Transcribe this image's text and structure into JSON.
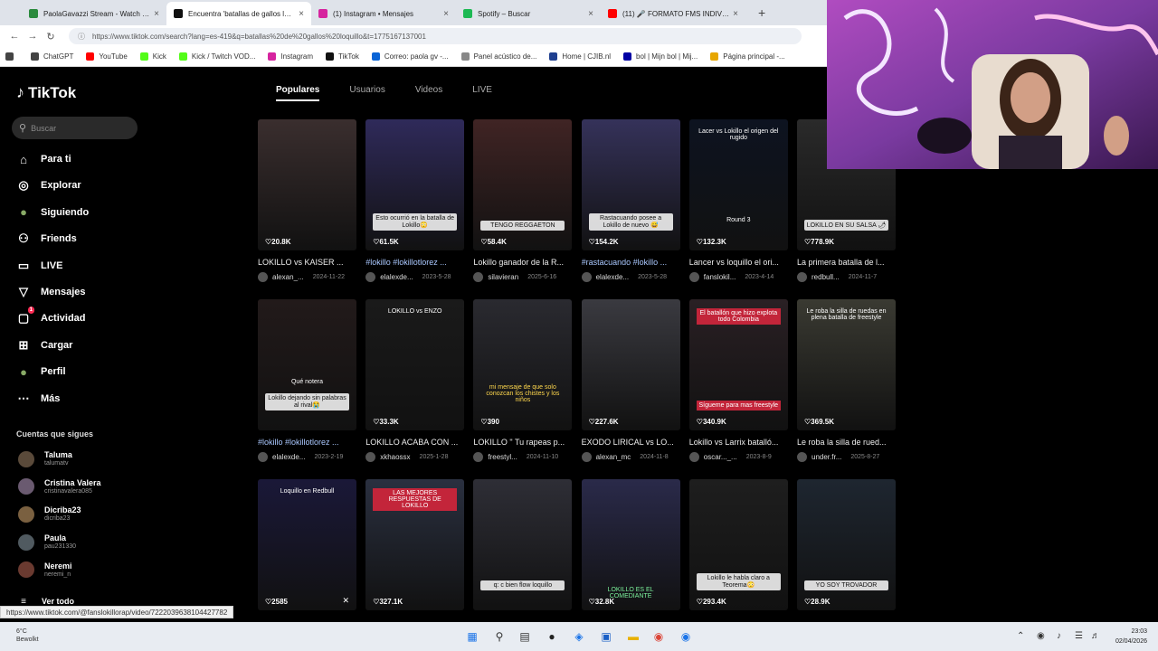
{
  "browser": {
    "tabs": [
      {
        "title": "PaolaGavazzi Stream - Watch Live",
        "color": "#2b8a3e",
        "active": false
      },
      {
        "title": "Encuentra 'batallas de gallos loquillo'",
        "color": "#111111",
        "active": true
      },
      {
        "title": "(1) Instagram • Mensajes",
        "color": "#d6249f",
        "active": false
      },
      {
        "title": "Spotify – Buscar",
        "color": "#1db954",
        "active": false
      },
      {
        "title": "(11) 🎤 FORMATO FMS INDIVIDUAL",
        "color": "#ff0000",
        "active": false
      }
    ],
    "new_tab": "+",
    "url": "https://www.tiktok.com/search?lang=es-419&q=batallas%20de%20gallos%20loquillo&t=1775167137001",
    "bookmarks": [
      {
        "label": "ChatGPT",
        "color": "#444444"
      },
      {
        "label": "YouTube",
        "color": "#ff0000"
      },
      {
        "label": "Kick",
        "color": "#53fc18"
      },
      {
        "label": "Kick / Twitch VOD...",
        "color": "#53fc18"
      },
      {
        "label": "Instagram",
        "color": "#d6249f"
      },
      {
        "label": "TikTok",
        "color": "#111111"
      },
      {
        "label": "Correo: paola gv -...",
        "color": "#0a64d6"
      },
      {
        "label": "Panel acústico de...",
        "color": "#888888"
      },
      {
        "label": "Home | CJIB.nl",
        "color": "#1f3f8f"
      },
      {
        "label": "bol | Mijn bol | Mij...",
        "color": "#0000a4"
      },
      {
        "label": "Página principal -...",
        "color": "#e7a600"
      }
    ]
  },
  "tiktok": {
    "logo": "TikTok",
    "search_placeholder": "Buscar",
    "nav": [
      {
        "label": "Para ti",
        "icon": "home-icon",
        "glyph": "⌂"
      },
      {
        "label": "Explorar",
        "icon": "compass-icon",
        "glyph": "◎"
      },
      {
        "label": "Siguiendo",
        "icon": "following-avatar-icon",
        "glyph": "●"
      },
      {
        "label": "Friends",
        "icon": "friends-icon",
        "glyph": "⚇"
      },
      {
        "label": "LIVE",
        "icon": "live-icon",
        "glyph": "▭"
      },
      {
        "label": "Mensajes",
        "icon": "messages-icon",
        "glyph": "▽"
      },
      {
        "label": "Actividad",
        "icon": "activity-icon",
        "glyph": "▢"
      },
      {
        "label": "Cargar",
        "icon": "upload-icon",
        "glyph": "⊞"
      },
      {
        "label": "Perfil",
        "icon": "profile-avatar-icon",
        "glyph": "●"
      },
      {
        "label": "Más",
        "icon": "more-icon",
        "glyph": "⋯"
      }
    ],
    "activity_badge": "1",
    "following_header": "Cuentas que sigues",
    "following": [
      {
        "name": "Taluma",
        "handle": "talumatv"
      },
      {
        "name": "Cristina Valera",
        "handle": "cristinavalera085"
      },
      {
        "name": "Dicriba23",
        "handle": "dicriba23"
      },
      {
        "name": "Paula",
        "handle": "pau231330"
      },
      {
        "name": "Neremi",
        "handle": "neremi_n"
      }
    ],
    "see_all": "Ver todo",
    "result_tabs": [
      "Populares",
      "Usuarios",
      "Videos",
      "LIVE"
    ],
    "active_tab": "Populares",
    "videos": [
      {
        "title": "LOKILLO vs KAISER ...",
        "user": "alexan_...",
        "date": "2024-11-22",
        "likes": "20.8K",
        "hashtag": false,
        "caption": "",
        "bg": "#3a2e2e"
      },
      {
        "title": "#lokillo #lokillotlorez ...",
        "user": "elalexde...",
        "date": "2023-5-28",
        "likes": "61.5K",
        "hashtag": true,
        "caption": "Esto ocurrió en la batalla de Lokillo😳",
        "bg": "#2f2a5a"
      },
      {
        "title": "Lokillo ganador de la R...",
        "user": "silavieran",
        "date": "2025-6-16",
        "likes": "58.4K",
        "hashtag": false,
        "caption": "",
        "bg": "#402424"
      },
      {
        "title": "#rastacuando #lokillo ...",
        "user": "elalexde...",
        "date": "2023-5-28",
        "likes": "154.2K",
        "hashtag": true,
        "caption": "Rastacuando posee a Lokillo de nuevo 😅",
        "bg": "#35325a"
      },
      {
        "title": "Lancer vs loquillo el ori...",
        "user": "fanslokil...",
        "date": "2023-4-14",
        "likes": "132.3K",
        "hashtag": false,
        "caption": "",
        "bg": "#0d1320"
      },
      {
        "title": "La primera batalla de l...",
        "user": "redbull...",
        "date": "2024-11-7",
        "likes": "778.9K",
        "hashtag": false,
        "caption": "LOKILLO EN SU SALSA 🌶",
        "bg": "#2a2a2a"
      },
      {
        "title": "#lokillo #lokillotlorez ...",
        "user": "elalexde...",
        "date": "2023-2-19",
        "likes": "",
        "hashtag": true,
        "caption": "Lokillo dejando sin palabras al rival😭",
        "bg": "#221a1a"
      },
      {
        "title": "LOKILLO ACABA CON ...",
        "user": "xkhaossx",
        "date": "2025-1-28",
        "likes": "33.3K",
        "hashtag": false,
        "caption": "",
        "bg": "#1a1a1a"
      },
      {
        "title": "LOKILLO \" Tu rapeas p...",
        "user": "freestyl...",
        "date": "2024-11-10",
        "likes": "390",
        "hashtag": false,
        "caption": "",
        "bg": "#2a2a30"
      },
      {
        "title": "EXODO LIRICAL vs LO...",
        "user": "alexan_mc",
        "date": "2024-11-8",
        "likes": "227.6K",
        "hashtag": false,
        "caption": "",
        "bg": "#3a3a40"
      },
      {
        "title": "Lokillo vs Larrix batalló...",
        "user": "oscar..._...",
        "date": "2023-8-9",
        "likes": "340.9K",
        "hashtag": false,
        "caption": "",
        "bg": "#2a2024"
      },
      {
        "title": "Le roba la silla de rued...",
        "user": "under.fr...",
        "date": "2025-8-27",
        "likes": "369.5K",
        "hashtag": false,
        "caption": "",
        "bg": "#3a3a32"
      },
      {
        "title": "",
        "user": "",
        "date": "",
        "likes": "2585",
        "hashtag": false,
        "caption": "",
        "bg": "#1a1838"
      },
      {
        "title": "",
        "user": "",
        "date": "",
        "likes": "327.1K",
        "hashtag": false,
        "caption": "",
        "bg": "#2a3040"
      },
      {
        "title": "",
        "user": "",
        "date": "",
        "likes": "",
        "hashtag": false,
        "caption": "",
        "bg": "#2e2e36"
      },
      {
        "title": "",
        "user": "",
        "date": "",
        "likes": "32.8K",
        "hashtag": false,
        "caption": "",
        "bg": "#2a2a4a"
      },
      {
        "title": "",
        "user": "",
        "date": "",
        "likes": "293.4K",
        "hashtag": false,
        "caption": "Lokillo le habla claro a Teorema😳",
        "bg": "#1e1e1e"
      },
      {
        "title": "",
        "user": "",
        "date": "",
        "likes": "28.9K",
        "hashtag": false,
        "caption": "",
        "bg": "#1e2630"
      }
    ],
    "overlay_texts": {
      "lancer_top": "Lacer vs Lokillo el origen del rugido",
      "lancer_round": "Round 3",
      "tengo_reggaeton": "TENGO REGGAETON",
      "lokillo_vs_enzo": "LOKILLO vs ENZO",
      "batallon": "El batallón que hizo explota todo Colombia",
      "siguemepara": "Sígueme para mas freestyle",
      "roba_silla": "Le roba la silla de ruedas en plena batalla de freestyle",
      "loquillo_redbull": "Loquillo en Redbull",
      "mejores_respuestas": "LAS MEJORES RESPUESTAS DE LOKILLO",
      "que_bien_flow": "q: c bien flow loquillo",
      "comediante": "LOKILLO ES EL COMEDIANTE",
      "yo_soy_trovador": "YO SOY TROVADOR",
      "que_nota": "Qué notera",
      "sin_palabras": "mi mensaje de que solo conozcan los chistes y los niños"
    }
  },
  "status_url": "https://www.tiktok.com/@fanslokillorap/video/7222039638104427782",
  "taskbar": {
    "temperature": "6°C",
    "weather": "Bewolkt",
    "time": "23:03",
    "date": "02/04/2026"
  }
}
